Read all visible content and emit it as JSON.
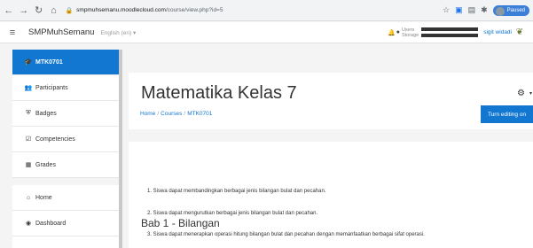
{
  "browser": {
    "back_icon": "arrow-left-icon",
    "forward_icon": "arrow-right-icon",
    "reload_icon": "reload-icon",
    "home_icon": "home-icon",
    "lock_icon": "lock-icon",
    "url_host": "smpmuhsemanu.moodlecloud.com",
    "url_path": "/course/view.php?id=5",
    "paused_label": "Paused"
  },
  "navbar": {
    "site_name": "SMPMuhSemanu",
    "language": "English (en) ▾",
    "users_label": "Users",
    "storage_label": "Storage",
    "user_name": "sigit widadi"
  },
  "drawer": {
    "items": [
      {
        "label": "MTK0701",
        "icon": "graduation-cap-icon",
        "glyph": "🎓"
      },
      {
        "label": "Participants",
        "icon": "users-icon",
        "glyph": "👥"
      },
      {
        "label": "Badges",
        "icon": "shield-icon",
        "glyph": "⛨"
      },
      {
        "label": "Competencies",
        "icon": "check-square-icon",
        "glyph": "☑"
      },
      {
        "label": "Grades",
        "icon": "table-icon",
        "glyph": "▦"
      },
      {
        "label": "Home",
        "icon": "home-icon",
        "glyph": "⌂"
      },
      {
        "label": "Dashboard",
        "icon": "dashboard-icon",
        "glyph": "◉"
      }
    ]
  },
  "header": {
    "course_title": "Matematika Kelas 7",
    "breadcrumb": [
      "Home",
      "Courses",
      "MTK0701"
    ],
    "edit_button": "Turn editing on"
  },
  "section": {
    "title": "Bab 1 - Bilangan",
    "lines": [
      "1. Siswa dapat membandingkan berbagai jenis bilangan bulat dan pecahan.",
      "2. Siswa dapat mengurutkan berbagai jenis bilangan bulat dan pecahan.",
      "3. Siswa dapat menerapkan operasi hitung bilangan bulat dan pecahan dengan memanfaatkan berbagai sifat operasi."
    ]
  },
  "colors": {
    "accent": "#1177d1"
  }
}
